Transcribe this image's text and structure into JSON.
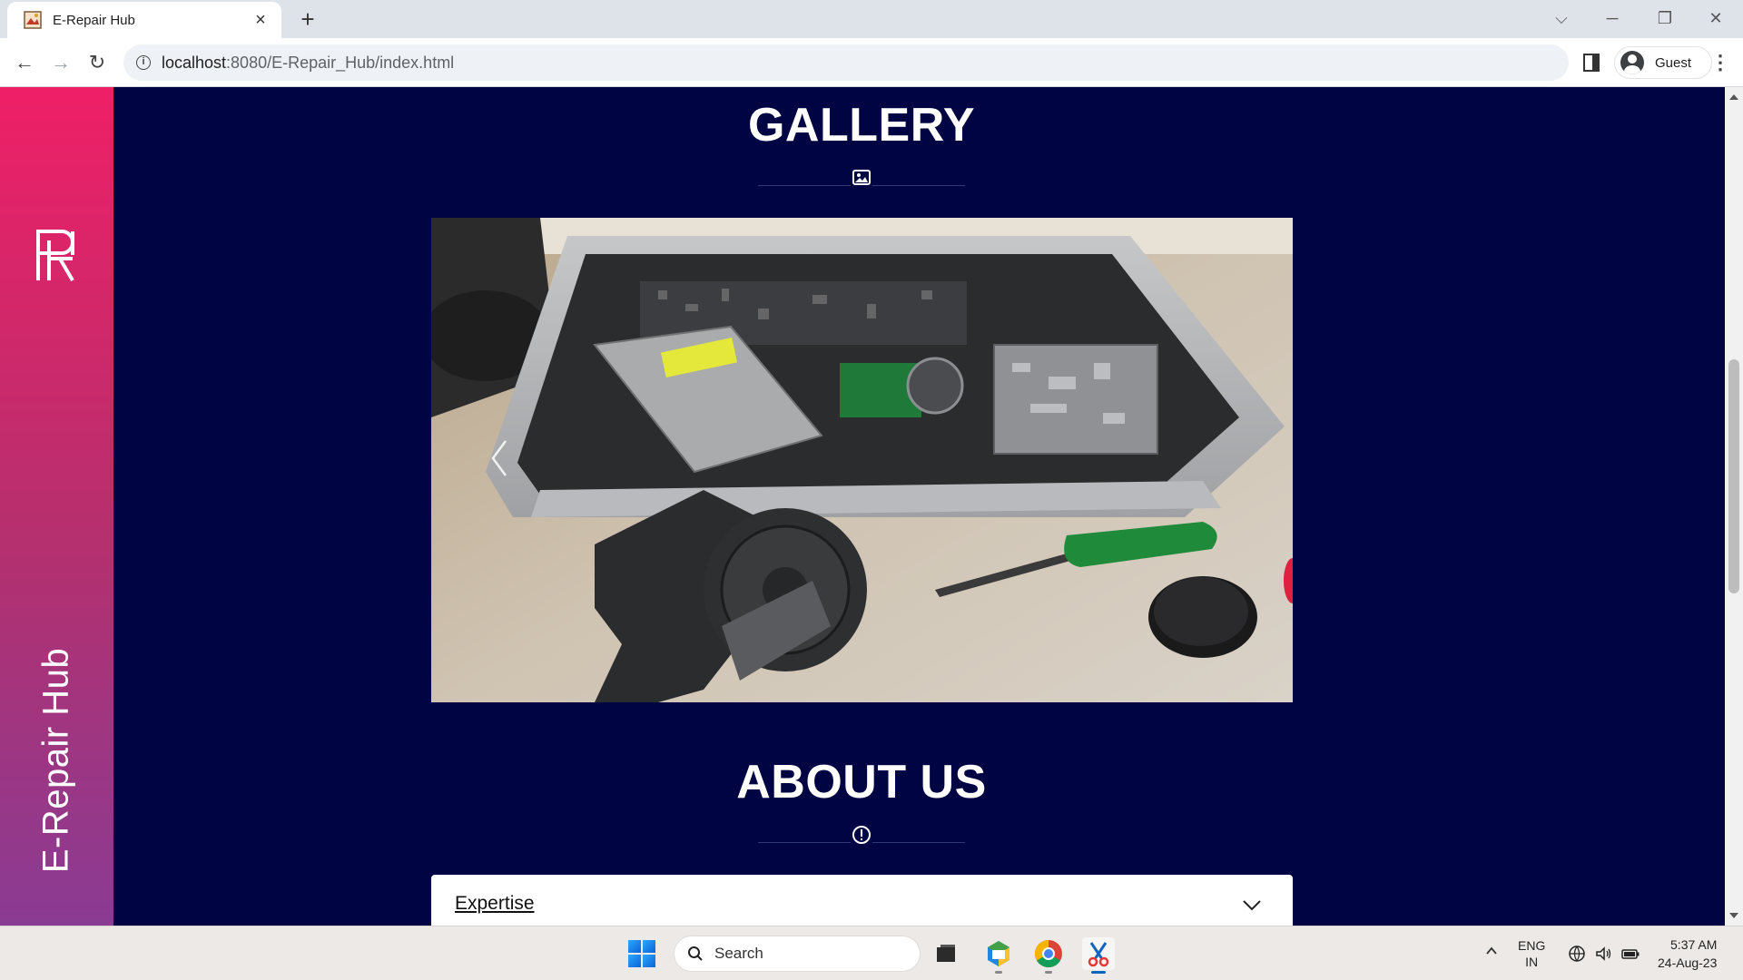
{
  "browser": {
    "tab_title": "E-Repair Hub",
    "new_tab_label": "+",
    "url_host": "localhost",
    "url_path": ":8080/E-Repair_Hub/index.html",
    "profile_label": "Guest"
  },
  "page": {
    "brand_name": "E-Repair Hub",
    "gallery_title": "GALLERY",
    "about_title": "ABOUT US",
    "accordion_item_label": "Expertise",
    "colors": {
      "page_background": "#000442",
      "sidebar_gradient_top": "#ef1f66",
      "sidebar_gradient_bottom": "#8a3b93"
    }
  },
  "taskbar": {
    "search_placeholder": "Search",
    "language_line1": "ENG",
    "language_line2": "IN",
    "time": "5:37 AM",
    "date": "24-Aug-23"
  },
  "icons": {
    "gallery_divider": "image-icon",
    "about_divider": "info-circle-icon",
    "carousel_prev": "chevron-left-icon",
    "accordion_toggle": "chevron-down-icon"
  }
}
